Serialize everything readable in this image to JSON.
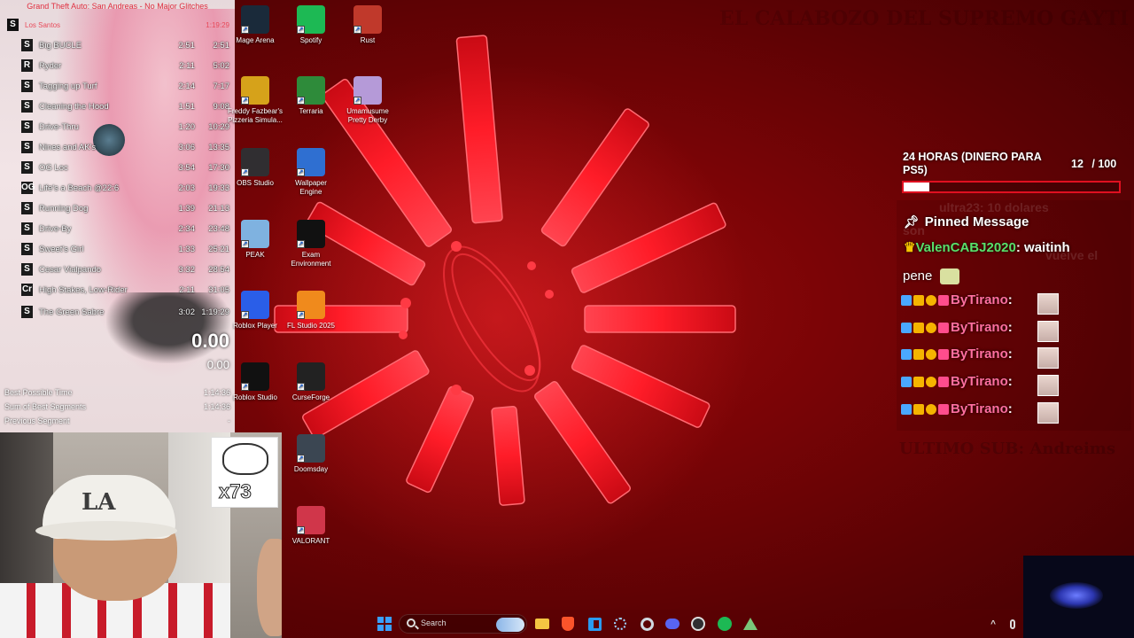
{
  "splits": {
    "title": "Grand Theft Auto: San Andreas - No Major Glitches",
    "category": "Los Santos",
    "category_time": "1:19:29",
    "rows": [
      {
        "icon": "S",
        "name": "Big BUCLE",
        "segment": "2:51",
        "total": "2:51"
      },
      {
        "icon": "R",
        "name": "Ryder",
        "segment": "2:11",
        "total": "5:02"
      },
      {
        "icon": "S",
        "name": "Tagging up Turf",
        "segment": "2:14",
        "total": "7:17"
      },
      {
        "icon": "S",
        "name": "Cleaning the Hood",
        "segment": "1:51",
        "total": "9:08"
      },
      {
        "icon": "S",
        "name": "Drive-Thru",
        "segment": "1:20",
        "total": "10:29"
      },
      {
        "icon": "S",
        "name": "Nines and AK's",
        "segment": "3:06",
        "total": "13:35"
      },
      {
        "icon": "S",
        "name": "OG Loc",
        "segment": "3:54",
        "total": "17:30"
      },
      {
        "icon": "OG",
        "name": "Life's a Beach @22:6",
        "segment": "2:03",
        "total": "19:33"
      },
      {
        "icon": "S",
        "name": "Running Dog",
        "segment": "1:39",
        "total": "21:13"
      },
      {
        "icon": "S",
        "name": "Drive-By",
        "segment": "2:34",
        "total": "23:48"
      },
      {
        "icon": "S",
        "name": "Sweet's Girl",
        "segment": "1:33",
        "total": "25:21"
      },
      {
        "icon": "S",
        "name": "Cesar Vialpando",
        "segment": "3:32",
        "total": "28:54"
      },
      {
        "icon": "Cr",
        "name": "High Stakes, Low-Rider",
        "segment": "2:11",
        "total": "31:05"
      },
      {
        "icon": "S",
        "name": "The Green Sabre",
        "segment": "3:02",
        "total": "1:19:29"
      }
    ],
    "timer": "0.00",
    "segment_timer": "0.00",
    "stats": [
      {
        "label": "Best Possible Time",
        "value": "1:14:36"
      },
      {
        "label": "Sum of Best Segments",
        "value": "1:14:36"
      },
      {
        "label": "Previous Segment",
        "value": "-"
      }
    ]
  },
  "webcam": {
    "sticker_text": "x73"
  },
  "desktop_icons": [
    {
      "label": "Mage Arena",
      "icon": "mage-arena-icon",
      "color": "#1a2a3a"
    },
    {
      "label": "Spotify",
      "icon": "spotify-icon",
      "color": "#1db954"
    },
    {
      "label": "Rust",
      "icon": "rust-icon",
      "color": "#c0392b"
    },
    {
      "label": "Freddy Fazbear's Pizzeria Simula...",
      "icon": "freddy-icon",
      "color": "#d6a21a"
    },
    {
      "label": "Terraria",
      "icon": "terraria-icon",
      "color": "#2e8b3a"
    },
    {
      "label": "Umamusume Pretty Derby",
      "icon": "umamusume-icon",
      "color": "#b59ad8"
    },
    {
      "label": "OBS Studio",
      "icon": "obs-icon",
      "color": "#302e31"
    },
    {
      "label": "Wallpaper Engine",
      "icon": "wallpaper-engine-icon",
      "color": "#2f6fd1"
    },
    {
      "label": "PEAK",
      "icon": "peak-icon",
      "color": "#7fb2e0"
    },
    {
      "label": "Exam Environment",
      "icon": "exam-icon",
      "color": "#111111"
    },
    {
      "label": "Roblox Player",
      "icon": "roblox-player-icon",
      "color": "#2a5ee8"
    },
    {
      "label": "FL Studio 2025",
      "icon": "fl-studio-icon",
      "color": "#f08a1c"
    },
    {
      "label": "Roblox Studio",
      "icon": "roblox-studio-icon",
      "color": "#111111"
    },
    {
      "label": "CurseForge",
      "icon": "curseforge-icon",
      "color": "#222222"
    },
    {
      "label": "Doomsday",
      "icon": "doomsday-icon",
      "color": "#3b4652"
    },
    {
      "label": "VALORANT",
      "icon": "valorant-icon",
      "color": "#d0364a"
    }
  ],
  "goal": {
    "title": "24 HORAS (DINERO PARA PS5)",
    "current": "12",
    "max": "/ 100",
    "progress": 0.12
  },
  "chat": {
    "ghost_lines": [
      "ultra23: 10 dolares",
      "son",
      "uni...",
      "vuelve el"
    ],
    "pinned_label": "Pinned Message",
    "pinned_user": "ValenCABJ2020",
    "pinned_text": "waitinh",
    "pinned_text2": "pene",
    "messages": [
      {
        "user": "ByTirano"
      },
      {
        "user": "ByTirano"
      },
      {
        "user": "ByTirano"
      },
      {
        "user": "ByTirano"
      },
      {
        "user": "ByTirano"
      }
    ]
  },
  "watermarks": {
    "top": "EL CALABOZO DEL SUPREMO GAYTI",
    "bottom": "ULTIMO SUB: Andreims"
  },
  "taskbar": {
    "search_placeholder": "Search",
    "apps": [
      "start-icon",
      "file-explorer-icon",
      "brave-icon",
      "vscode-icon",
      "network-icon",
      "settings-icon",
      "discord-icon",
      "obs-icon",
      "spotify-icon",
      "app-icon"
    ]
  },
  "colors": {
    "accent_red": "#e01020",
    "chat_user": "#ff6fa0",
    "pinned_user": "#58e06a",
    "split_title": "#e03040"
  }
}
